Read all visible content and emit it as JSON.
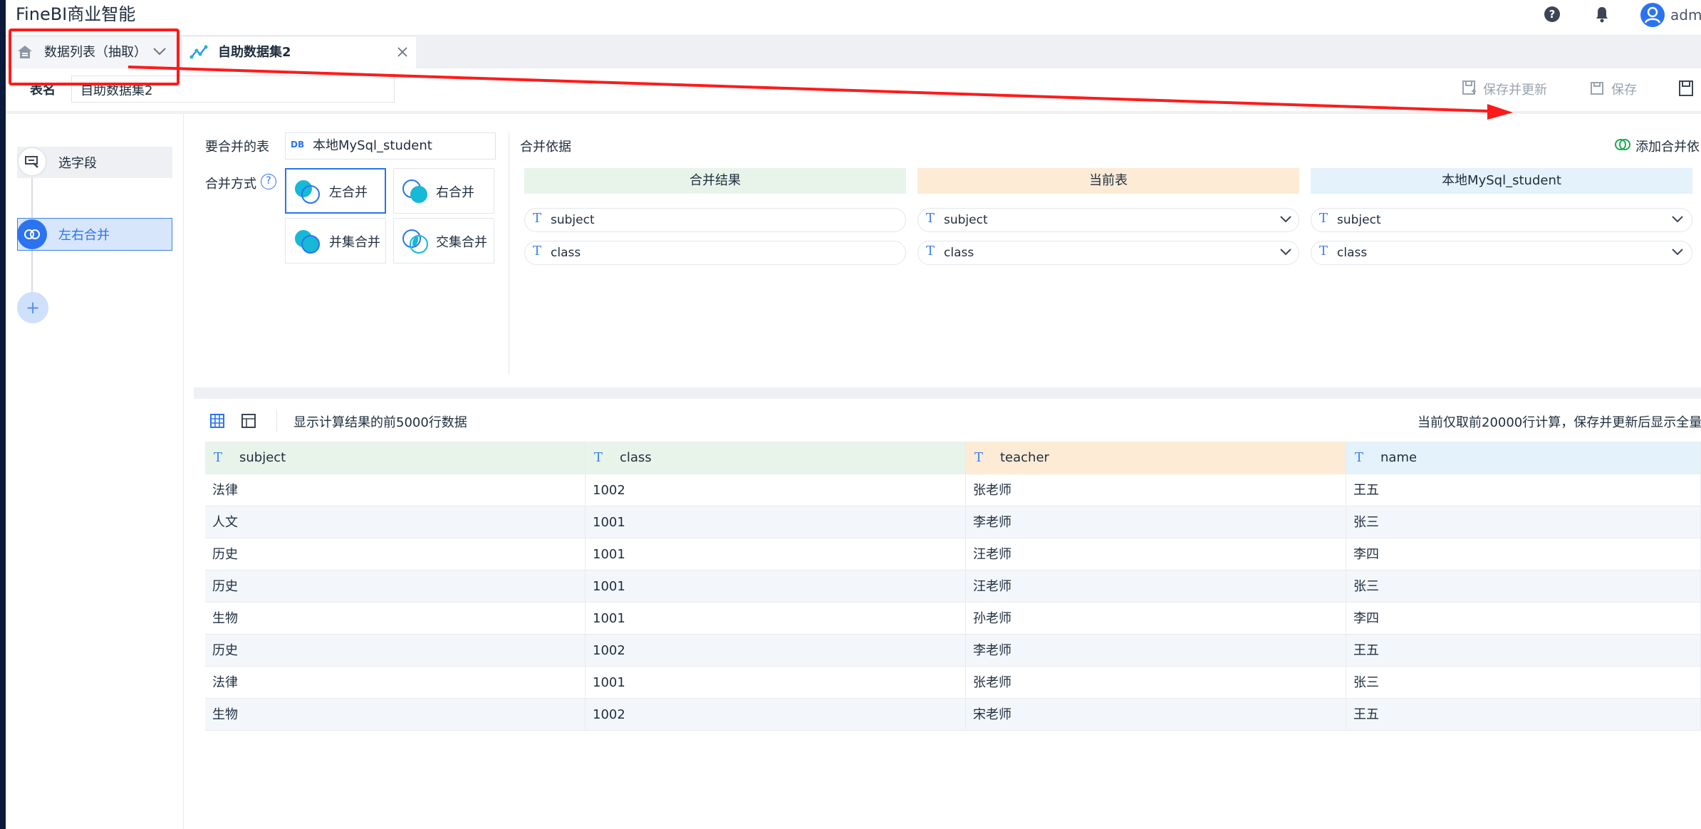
{
  "app": {
    "title": "FineBI商业智能",
    "user": "adm"
  },
  "tabs": [
    {
      "label": "数据列表（抽取）"
    },
    {
      "label": "自助数据集2"
    }
  ],
  "name_row": {
    "label": "表名",
    "value": "自助数据集2",
    "save_update": "保存并更新",
    "save": "保存"
  },
  "steps": [
    {
      "label": "选字段"
    },
    {
      "label": "左右合并"
    }
  ],
  "config": {
    "table_label": "要合并的表",
    "table_value": "本地MySql_student",
    "db_badge": "DB",
    "method_label": "合并方式",
    "help": "?",
    "methods": [
      "左合并",
      "右合并",
      "并集合并",
      "交集合并"
    ],
    "basis_label": "合并依据",
    "add_basis": "添加合并依",
    "columns": [
      "合并结果",
      "当前表",
      "本地MySql_student"
    ],
    "fields": [
      {
        "result": "subject",
        "current": "subject",
        "other": "subject"
      },
      {
        "result": "class",
        "current": "class",
        "other": "class"
      }
    ]
  },
  "grid": {
    "info": "显示计算结果的前5000行数据",
    "note": "当前仅取前20000行计算，保存并更新后显示全量",
    "headers": [
      "subject",
      "class",
      "teacher",
      "name"
    ],
    "header_colors": [
      "#e8f4ea",
      "#e8f4ea",
      "#fdebd6",
      "#e3f2fb"
    ],
    "rows": [
      [
        "法律",
        "1002",
        "张老师",
        "王五"
      ],
      [
        "人文",
        "1001",
        "李老师",
        "张三"
      ],
      [
        "历史",
        "1001",
        "汪老师",
        "李四"
      ],
      [
        "历史",
        "1001",
        "汪老师",
        "张三"
      ],
      [
        "生物",
        "1001",
        "孙老师",
        "李四"
      ],
      [
        "历史",
        "1002",
        "李老师",
        "王五"
      ],
      [
        "法律",
        "1001",
        "张老师",
        "张三"
      ],
      [
        "生物",
        "1002",
        "宋老师",
        "王五"
      ]
    ]
  },
  "colors": {
    "accent": "#2b73f0",
    "annotation": "#ff1a1a",
    "result_head": "#e8f4ea",
    "current_head": "#fdebd6",
    "other_head": "#e3f2fb"
  },
  "icons": [
    "help-icon",
    "bell-icon",
    "user-icon",
    "home-icon",
    "chevron-down-icon",
    "dataset-icon",
    "close-icon",
    "save-update-icon",
    "save-icon",
    "field-select-icon",
    "merge-icon",
    "plus-icon",
    "db-icon",
    "venn-icon",
    "add-basis-icon",
    "text-type-icon",
    "grid-view-icon",
    "layout-view-icon"
  ]
}
